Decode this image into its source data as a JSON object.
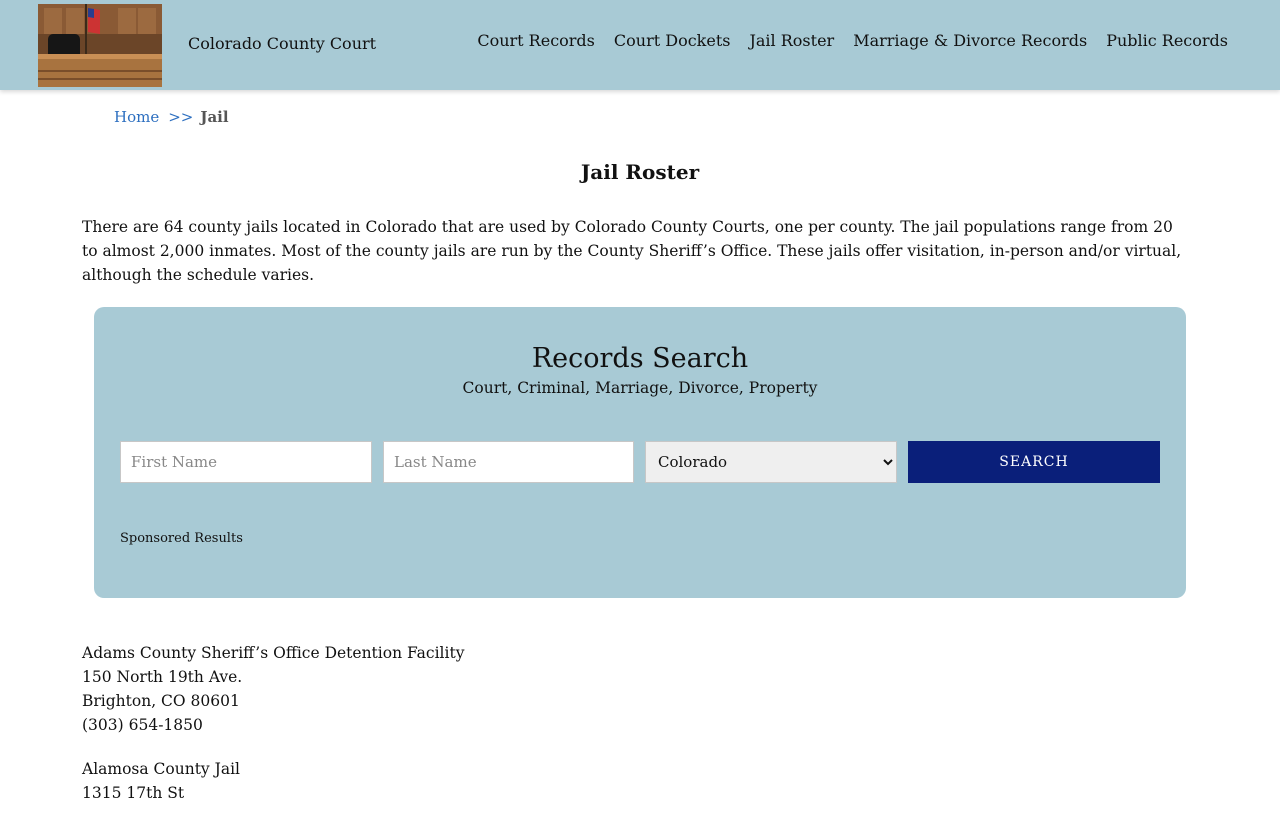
{
  "header": {
    "site_title": "Colorado County Court",
    "nav": [
      {
        "label": "Court Records"
      },
      {
        "label": "Court Dockets"
      },
      {
        "label": "Jail Roster"
      },
      {
        "label": "Marriage & Divorce Records"
      },
      {
        "label": "Public Records"
      }
    ]
  },
  "breadcrumb": {
    "home": "Home",
    "separator": ">>",
    "current": "Jail"
  },
  "page_title": "Jail Roster",
  "intro": "There are 64 county jails located in Colorado that are used by Colorado County Courts, one per county. The jail populations range from 20 to almost 2,000 inmates. Most of the county jails are run by the County Sheriff’s Office. These jails offer visitation, in-person and/or virtual, although the schedule varies.",
  "search": {
    "title": "Records Search",
    "subtitle": "Court, Criminal, Marriage, Divorce, Property",
    "first_name_placeholder": "First Name",
    "last_name_placeholder": "Last Name",
    "state_selected": "Colorado",
    "button_label": "SEARCH",
    "sponsored": "Sponsored Results"
  },
  "listings": [
    {
      "name": "Adams County Sheriff’s Office Detention Facility",
      "street": "150 North 19th Ave.",
      "city": "Brighton, CO 80601",
      "phone": "(303) 654-1850"
    },
    {
      "name": "Alamosa County Jail",
      "street": "1315 17th St",
      "city": "",
      "phone": ""
    }
  ],
  "colors": {
    "header_bg": "#a8cad5",
    "button_bg": "#0a1f7a",
    "link": "#2d6fc0"
  }
}
